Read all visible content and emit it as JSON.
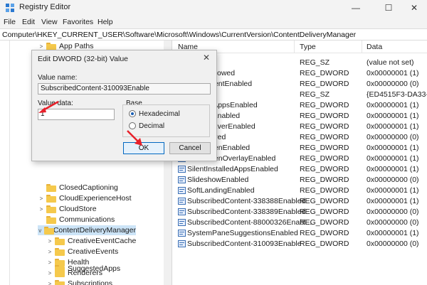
{
  "window": {
    "title": "Registry Editor",
    "minimize_glyph": "—",
    "maximize_glyph": "☐",
    "close_glyph": "✕",
    "app_icon": "registry-editor-icon"
  },
  "menu": [
    "File",
    "Edit",
    "View",
    "Favorites",
    "Help"
  ],
  "address": "Computer\\HKEY_CURRENT_USER\\Software\\Microsoft\\Windows\\CurrentVersion\\ContentDeliveryManager",
  "tree": {
    "items": [
      {
        "label": "App Paths",
        "chevron": ">"
      },
      {
        "label": "",
        "chevron": ""
      },
      {
        "label": "",
        "chevron": ""
      },
      {
        "label": "",
        "chevron": ""
      },
      {
        "label": "",
        "chevron": ""
      },
      {
        "label": "",
        "chevron": ""
      },
      {
        "label": "",
        "chevron": ""
      },
      {
        "label": "",
        "chevron": ""
      },
      {
        "label": "",
        "chevron": ""
      },
      {
        "label": "",
        "chevron": ""
      },
      {
        "label": "",
        "chevron": ""
      },
      {
        "label": "ClosedCaptioning",
        "chevron": ""
      },
      {
        "label": "CloudExperienceHost",
        "chevron": ">"
      },
      {
        "label": "CloudStore",
        "chevron": ">"
      },
      {
        "label": "Communications",
        "chevron": ""
      },
      {
        "label": "ContentDeliveryManager",
        "chevron": "v"
      },
      {
        "label": "CreativeEventCache",
        "chevron": ">"
      },
      {
        "label": "CreativeEvents",
        "chevron": ">"
      },
      {
        "label": "Health",
        "chevron": ">"
      },
      {
        "label": "Renderers",
        "chevron": ">"
      },
      {
        "label": "Subscriptions",
        "chevron": ">"
      },
      {
        "label": "SuggestedApps",
        "chevron": ""
      }
    ]
  },
  "list": {
    "columns": {
      "name": "Name",
      "type": "Type",
      "data": "Data"
    },
    "rows": [
      {
        "name": "",
        "type": "REG_SZ",
        "data": "(value not set)",
        "icon": "string-value-icon"
      },
      {
        "name": "eliveryAllowed",
        "type": "REG_DWORD",
        "data": "0x00000001 (1)",
        "icon": "dword-value-icon"
      },
      {
        "name": "anagementEnabled",
        "type": "REG_DWORD",
        "data": "0x00000000 (0)",
        "icon": "dword-value-icon"
      },
      {
        "name": "ovider",
        "type": "REG_SZ",
        "data": "{ED4515F3-DA33-47",
        "icon": "string-value-icon"
      },
      {
        "name": "nstalledAppsEnabled",
        "type": "REG_DWORD",
        "data": "0x00000001 (1)",
        "icon": "dword-value-icon"
      },
      {
        "name": "edAppsEnabled",
        "type": "REG_DWORD",
        "data": "0x00000001 (1)",
        "icon": "dword-value-icon"
      },
      {
        "name": "edAppsEverEnabled",
        "type": "REG_DWORD",
        "data": "0x00000001 (1)",
        "icon": "dword-value-icon"
      },
      {
        "name": "onRequired",
        "type": "REG_DWORD",
        "data": "0x00000000 (0)",
        "icon": "dword-value-icon"
      },
      {
        "name": "ockScreenEnabled",
        "type": "REG_DWORD",
        "data": "0x00000001 (1)",
        "icon": "dword-value-icon"
      },
      {
        "name": "ockScreenOverlayEnabled",
        "type": "REG_DWORD",
        "data": "0x00000001 (1)",
        "icon": "dword-value-icon"
      },
      {
        "name": "SilentInstalledAppsEnabled",
        "type": "REG_DWORD",
        "data": "0x00000001 (1)",
        "icon": "dword-value-icon"
      },
      {
        "name": "SlideshowEnabled",
        "type": "REG_DWORD",
        "data": "0x00000000 (0)",
        "icon": "dword-value-icon"
      },
      {
        "name": "SoftLandingEnabled",
        "type": "REG_DWORD",
        "data": "0x00000001 (1)",
        "icon": "dword-value-icon"
      },
      {
        "name": "SubscribedContent-338388Enabled",
        "type": "REG_DWORD",
        "data": "0x00000001 (1)",
        "icon": "dword-value-icon"
      },
      {
        "name": "SubscribedContent-338389Enabled",
        "type": "REG_DWORD",
        "data": "0x00000000 (0)",
        "icon": "dword-value-icon"
      },
      {
        "name": "SubscribedContent-88000326Enabl...",
        "type": "REG_DWORD",
        "data": "0x00000000 (0)",
        "icon": "dword-value-icon"
      },
      {
        "name": "SystemPaneSuggestionsEnabled",
        "type": "REG_DWORD",
        "data": "0x00000001 (1)",
        "icon": "dword-value-icon"
      },
      {
        "name": "SubscribedContent-310093Enable",
        "type": "REG_DWORD",
        "data": "0x00000000 (0)",
        "icon": "dword-value-icon"
      }
    ]
  },
  "dialog": {
    "title": "Edit DWORD (32-bit) Value",
    "close_glyph": "✕",
    "value_name_label": "Value name:",
    "value_name": "SubscribedContent-310093Enable",
    "value_data_label": "Value data:",
    "value_data": "1",
    "base_label": "Base",
    "hex_label": "Hexadecimal",
    "dec_label": "Decimal",
    "selected_base": "Hexadecimal",
    "ok_label": "OK",
    "cancel_label": "Cancel"
  },
  "colors": {
    "annotation": "#e8202a",
    "selection": "#cce4f7",
    "folder": "#f5c94c"
  }
}
